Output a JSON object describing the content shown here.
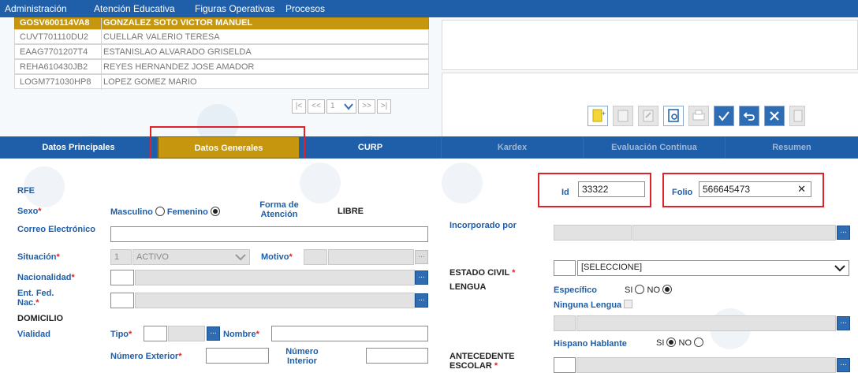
{
  "menu": [
    "Administración",
    "Atención Educativa",
    "Figuras Operativas",
    "Procesos"
  ],
  "grid": {
    "rows": [
      {
        "curp": "GOSV600114VA8",
        "name": "GONZALEZ SOTO VICTOR MANUEL",
        "selected": true
      },
      {
        "curp": "CUVT701110DU2",
        "name": "CUELLAR VALERIO TERESA",
        "selected": false
      },
      {
        "curp": "EAAG7701207T4",
        "name": "ESTANISLAO ALVARADO GRISELDA",
        "selected": false
      },
      {
        "curp": "REHA610430JB2",
        "name": "REYES HERNANDEZ JOSE AMADOR",
        "selected": false
      },
      {
        "curp": "LOGM771030HP8",
        "name": "LOPEZ GOMEZ MARIO",
        "selected": false
      }
    ],
    "pager": {
      "first": "|<",
      "prev": "<<",
      "page": "1",
      "next": ">>",
      "last": ">|"
    }
  },
  "toolbar_icons": [
    "new-icon",
    "doc-icon",
    "edit-icon",
    "search-doc-icon",
    "print-icon",
    "check-icon",
    "undo-icon",
    "close-icon",
    "last-icon"
  ],
  "tabs": [
    "Datos Principales",
    "Datos Generales",
    "CURP",
    "Kardex",
    "Evaluación Continua",
    "Resumen"
  ],
  "active_tab": "Datos Generales",
  "form": {
    "rfe": "RFE",
    "sexo_label": "Sexo",
    "masculino": "Masculino",
    "femenino": "Femenino",
    "forma_atencion": "Forma de Atención",
    "forma_atencion_value": "LIBRE",
    "correo": "Correo Electrónico",
    "situacion": "Situación",
    "situacion_code": "1",
    "situacion_value": "ACTIVO",
    "motivo": "Motivo",
    "nacionalidad": "Nacionalidad",
    "ent_fed": "Ent. Fed. Nac.",
    "domicilio": "DOMICILIO",
    "vialidad": "Vialidad",
    "tipo": "Tipo",
    "nombre": "Nombre",
    "num_exterior": "Número Exterior",
    "num_interior": "Número Interior",
    "id_label": "Id",
    "id_value": "33322",
    "folio_label": "Folio",
    "folio_value": "566645473",
    "incorporado": "Incorporado por",
    "estado_civil": "ESTADO CIVIL",
    "estado_civil_value": "[SELECCIONE]",
    "lengua": "LENGUA",
    "especifico": "Específico",
    "si": "SI",
    "no": "NO",
    "ninguna_lengua": "Ninguna Lengua",
    "hispano": "Hispano Hablante",
    "antecedente": "ANTECEDENTE ESCOLAR",
    "required_mark": "*",
    "ellipsis": "...",
    "clear": "✕"
  },
  "colors": {
    "primary": "#1f5ea8",
    "accent": "#c6960e",
    "required": "#e0202a",
    "highlight": "#e0202a"
  }
}
